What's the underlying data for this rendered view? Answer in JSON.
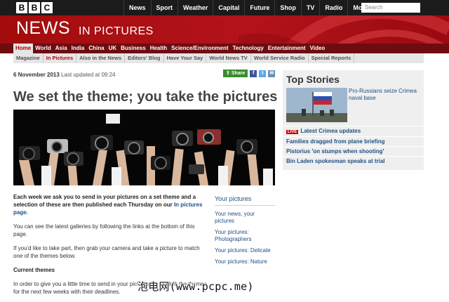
{
  "topbar": {
    "logo_letters": [
      "B",
      "B",
      "C"
    ],
    "nav": [
      "News",
      "Sport",
      "Weather",
      "Capital",
      "Future",
      "Shop",
      "TV",
      "Radio",
      "More..."
    ],
    "search_placeholder": "Search"
  },
  "masthead": {
    "brand": "NEWS",
    "section": "IN PICTURES"
  },
  "nav_primary": [
    "Home",
    "World",
    "Asia",
    "India",
    "China",
    "UK",
    "Business",
    "Health",
    "Science/Environment",
    "Technology",
    "Entertainment",
    "Video"
  ],
  "nav_primary_active": "Home",
  "nav_secondary": [
    "Magazine",
    "In Pictures",
    "Also in the News",
    "Editors' Blog",
    "Have Your Say",
    "World News TV",
    "World Service Radio",
    "Special Reports"
  ],
  "nav_secondary_active": "In Pictures",
  "article": {
    "date": "6 November 2013",
    "updated": "Last updated at 09:24",
    "share_label": "Share",
    "headline": "We set the theme; you take the pictures",
    "intro_text": "Each week we ask you to send in your pictures on a set theme and a selection of these are then published each Thursday on our",
    "intro_link": "In pictures page.",
    "para2": "You can see the latest galleries by following the links at the bottom of this page.",
    "para3": "If you'd like to take part, then grab your camera and take a picture to match one of the themes below.",
    "subhead": "Current themes",
    "para4": "In order to give you a little time to send in your pictures we publish the themes for the next few weeks with their deadlines."
  },
  "sidebar": {
    "title": "Your pictures",
    "items": [
      "Your news, your pictures",
      "Your pictures: Photographers",
      "Your pictures: Delicate",
      "Your pictures: Nature"
    ]
  },
  "top_stories": {
    "title": "Top Stories",
    "lead": "Pro-Russians seize Crimea naval base",
    "live_badge": "LIVE",
    "items": [
      "Latest Crimea updates",
      "Families dragged from plane briefing",
      "Pistorius 'on stumps when shooting'",
      "Bin Laden spokesman speaks at trial"
    ]
  },
  "watermark": "泡电网(www.pcpc.me)",
  "colors": {
    "bbc_red": "#b3131b",
    "dark_nav": "#6e0c10",
    "link_blue": "#1f4f82",
    "share_green": "#3b8b2f"
  },
  "icons": [
    "facebook-icon",
    "twitter-icon",
    "email-icon"
  ]
}
